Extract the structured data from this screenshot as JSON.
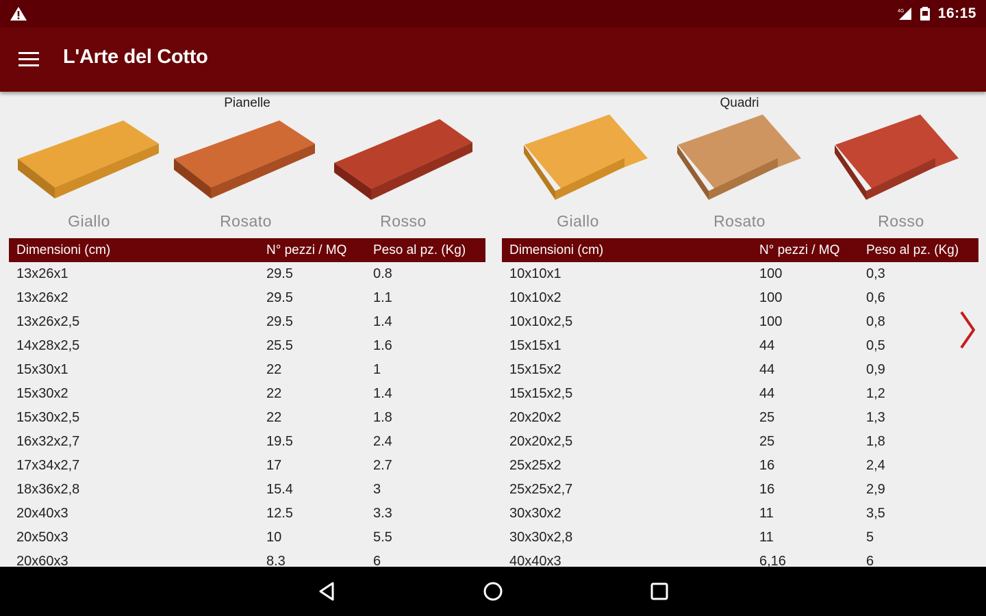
{
  "status_bar": {
    "time": "16:15",
    "icons": [
      "warning-icon",
      "signal-icon",
      "battery-icon"
    ]
  },
  "app_bar": {
    "title": "L'Arte del Cotto",
    "menu_icon": "hamburger-menu-icon"
  },
  "colors": {
    "brand_dark": "#5d0006",
    "brand": "#6a0407",
    "background": "#efefef",
    "arrow": "#c41e1e"
  },
  "sections": [
    {
      "title": "Pianelle",
      "tiles": [
        {
          "name": "Giallo",
          "color": "#e9a53a"
        },
        {
          "name": "Rosato",
          "color": "#cf6a34"
        },
        {
          "name": "Rosso",
          "color": "#b9412b"
        }
      ],
      "table": {
        "headers": [
          "Dimensioni (cm)",
          "N° pezzi / MQ",
          "Peso al pz. (Kg)"
        ],
        "rows": [
          [
            "13x26x1",
            "29.5",
            "0.8"
          ],
          [
            "13x26x2",
            "29.5",
            "1.1"
          ],
          [
            "13x26x2,5",
            "29.5",
            "1.4"
          ],
          [
            "14x28x2,5",
            "25.5",
            "1.6"
          ],
          [
            "15x30x1",
            "22",
            "1"
          ],
          [
            "15x30x2",
            "22",
            "1.4"
          ],
          [
            "15x30x2,5",
            "22",
            "1.8"
          ],
          [
            "16x32x2,7",
            "19.5",
            "2.4"
          ],
          [
            "17x34x2,7",
            "17",
            "2.7"
          ],
          [
            "18x36x2,8",
            "15.4",
            "3"
          ],
          [
            "20x40x3",
            "12.5",
            "3.3"
          ],
          [
            "20x50x3",
            "10",
            "5.5"
          ],
          [
            "20x60x3",
            "8.3",
            "6"
          ]
        ]
      }
    },
    {
      "title": "Quadri",
      "tiles": [
        {
          "name": "Giallo",
          "color": "#eda944"
        },
        {
          "name": "Rosato",
          "color": "#cf9560"
        },
        {
          "name": "Rosso",
          "color": "#c24632"
        }
      ],
      "table": {
        "headers": [
          "Dimensioni (cm)",
          "N° pezzi / MQ",
          "Peso al pz. (Kg)"
        ],
        "rows": [
          [
            "10x10x1",
            "100",
            "0,3"
          ],
          [
            "10x10x2",
            "100",
            "0,6"
          ],
          [
            "10x10x2,5",
            "100",
            "0,8"
          ],
          [
            "15x15x1",
            "44",
            "0,5"
          ],
          [
            "15x15x2",
            "44",
            "0,9"
          ],
          [
            "15x15x2,5",
            "44",
            "1,2"
          ],
          [
            "20x20x2",
            "25",
            "1,3"
          ],
          [
            "20x20x2,5",
            "25",
            "1,8"
          ],
          [
            "25x25x2",
            "16",
            "2,4"
          ],
          [
            "25x25x2,7",
            "16",
            "2,9"
          ],
          [
            "30x30x2",
            "11",
            "3,5"
          ],
          [
            "30x30x2,8",
            "11",
            "5"
          ],
          [
            "40x40x3",
            "6,16",
            "6"
          ]
        ]
      }
    }
  ],
  "nav_bar": {
    "buttons": [
      "back-icon",
      "home-icon",
      "recents-icon"
    ]
  }
}
